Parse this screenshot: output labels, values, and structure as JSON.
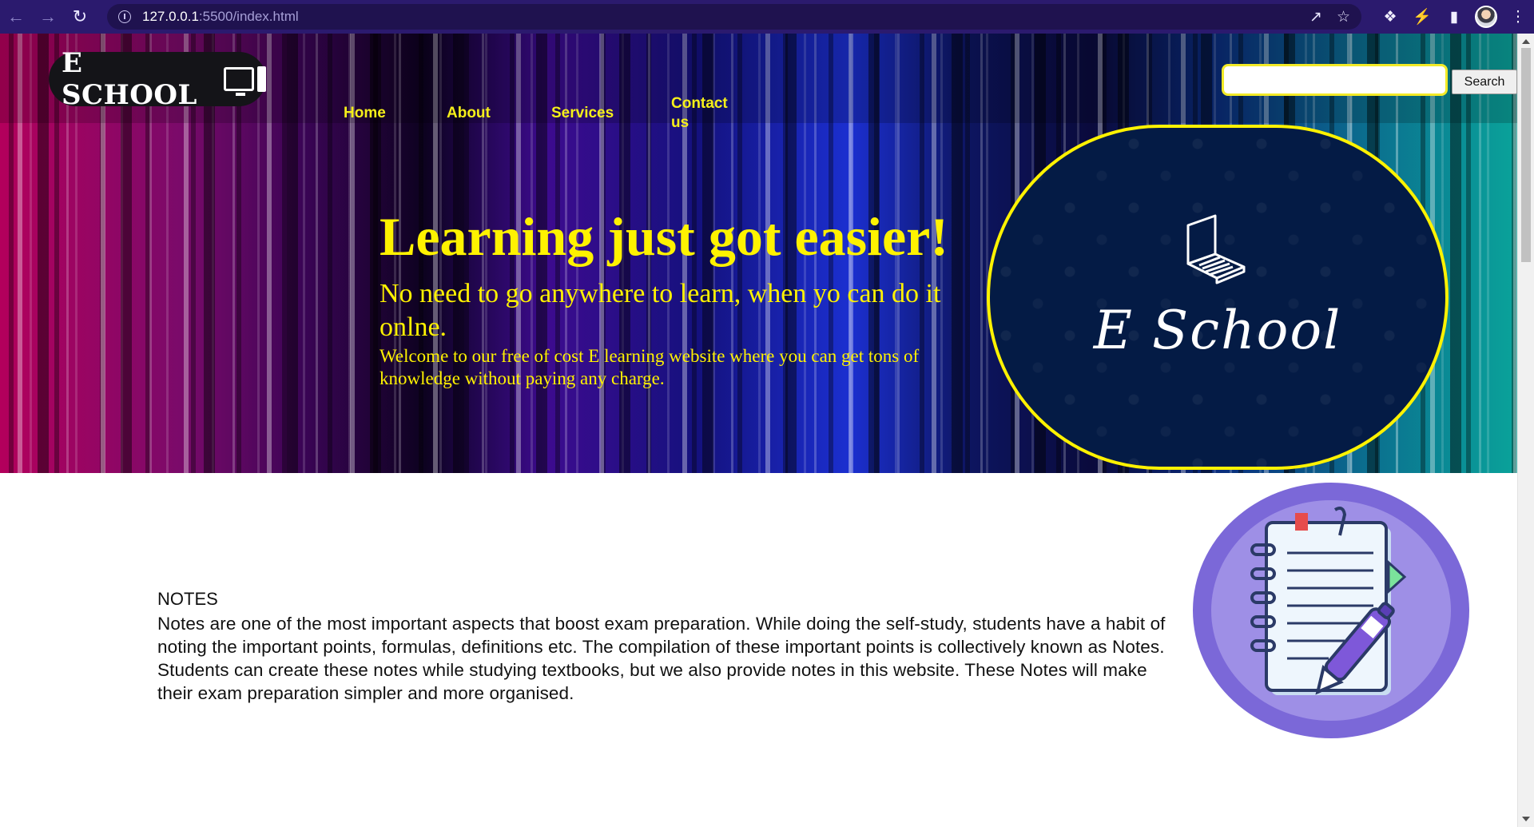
{
  "browser": {
    "url_host": "127.0.0.1",
    "url_path": ":5500/index.html",
    "back_icon": "arrow-left-icon",
    "forward_icon": "arrow-right-icon",
    "reload_icon": "reload-icon",
    "info_icon": "info-icon",
    "share_icon": "share-icon",
    "star_icon": "star-icon",
    "extensions_icon": "puzzle-icon",
    "sidebar_icon": "sidebar-icon",
    "menu_icon": "kebab-menu-icon"
  },
  "header": {
    "logo_text": "E SCHOOL",
    "nav": [
      {
        "label": "Home"
      },
      {
        "label": "About"
      },
      {
        "label": "Services"
      },
      {
        "label": "Contact us"
      }
    ],
    "search": {
      "placeholder": "",
      "value": "",
      "button_label": "Search"
    }
  },
  "hero": {
    "title": "Learning just got easier!",
    "subtitle": "No need to go anywhere to learn, when yo can do it onlne.",
    "description": "Welcome to our free of cost E learning website where you can get tons of knowledge without paying any charge.",
    "brand_name": "E School"
  },
  "notes": {
    "heading": "NOTES",
    "body": "Notes are one of the most important aspects that boost exam preparation. While doing the self-study, students have a habit of noting the important points, formulas, definitions etc. The compilation of these important points is collectively known as Notes. Students can create these notes while studying textbooks, but we also provide notes in this website. These Notes will make their exam preparation simpler and more organised."
  },
  "colors": {
    "accent_yellow": "#fff200",
    "browser_bar": "#2b1a6e",
    "oval_bg": "#041b45",
    "notes_circle": "#7b68d8"
  }
}
